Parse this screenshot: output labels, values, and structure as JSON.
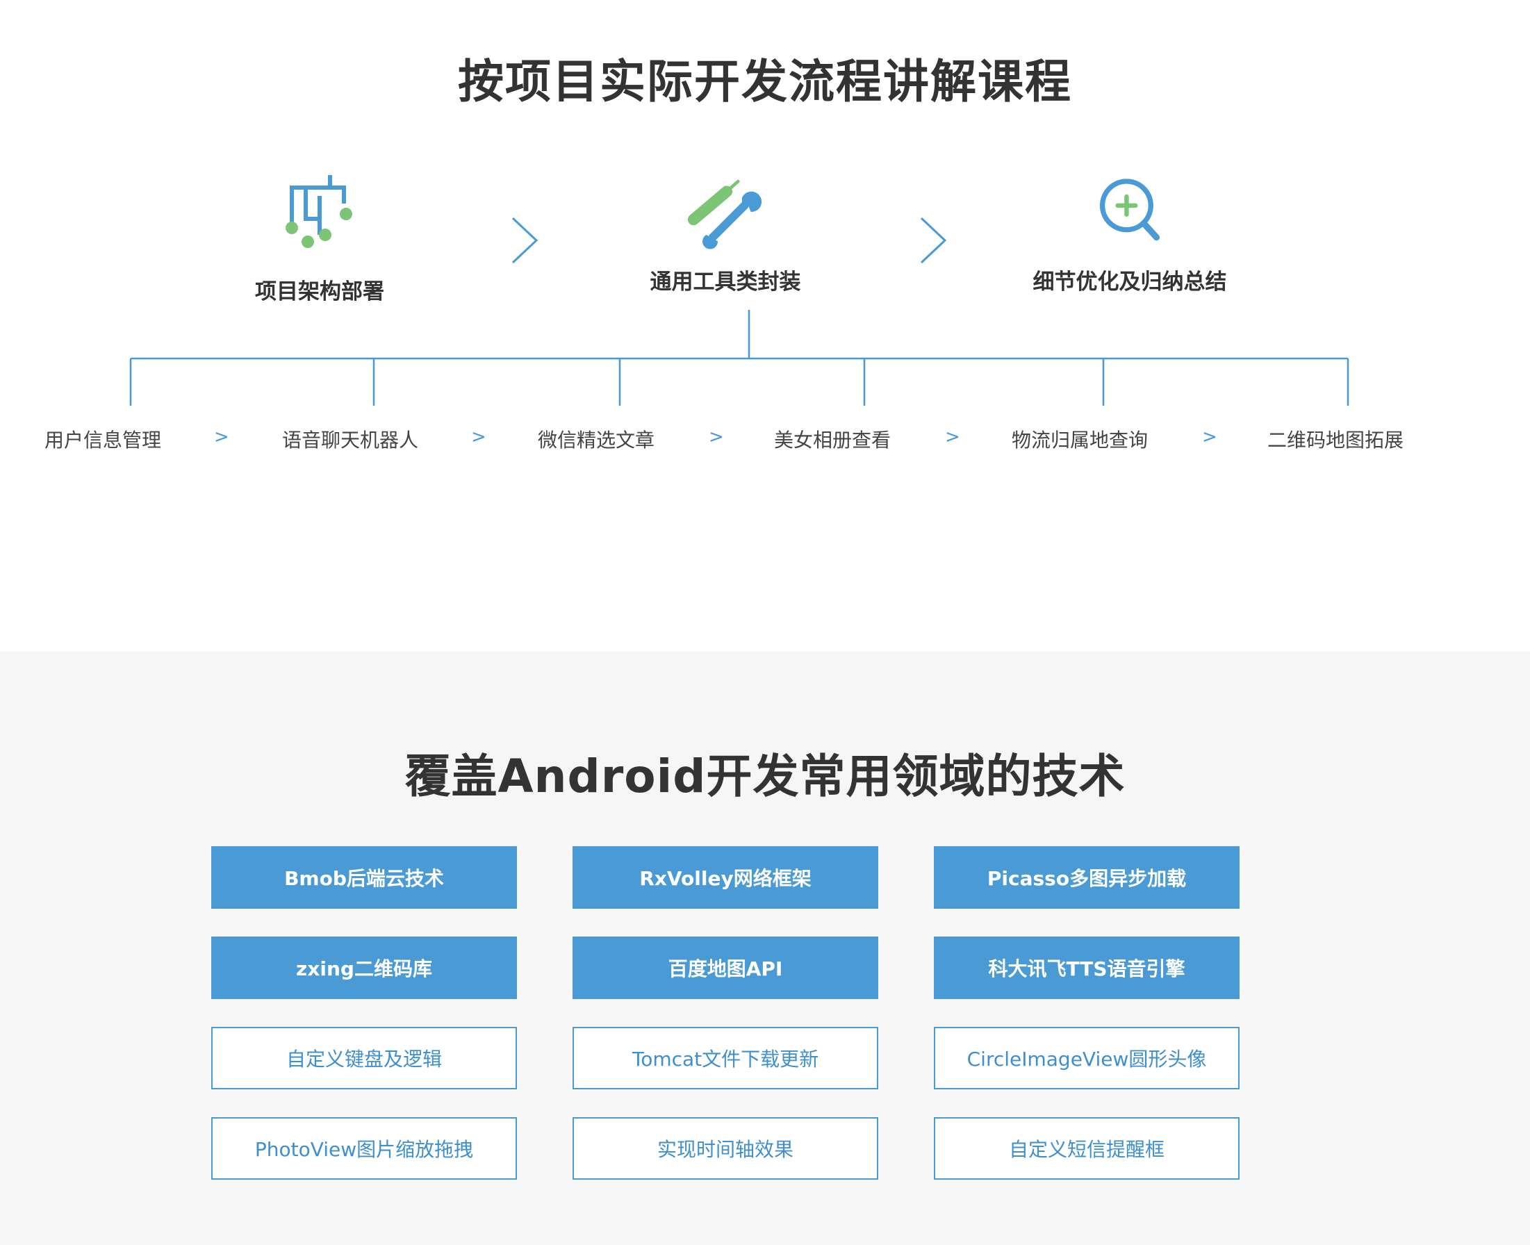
{
  "section_top": {
    "title": "按项目实际开发流程讲解课程",
    "phases": [
      {
        "label": "项目架构部署",
        "icon": "hierarchy-icon"
      },
      {
        "label": "通用工具类封装",
        "icon": "tools-icon"
      },
      {
        "label": "细节优化及归纳总结",
        "icon": "zoom-in-icon"
      }
    ],
    "steps": [
      "用户信息管理",
      "语音聊天机器人",
      "微信精选文章",
      "美女相册查看",
      "物流归属地查询",
      "二维码地图拓展"
    ],
    "step_separator": ">"
  },
  "section_bottom": {
    "title": "覆盖Android开发常用领域的技术",
    "techs": [
      {
        "label": "Bmob后端云技术",
        "style": "filled"
      },
      {
        "label": "RxVolley网络框架",
        "style": "filled"
      },
      {
        "label": "Picasso多图异步加载",
        "style": "filled"
      },
      {
        "label": "zxing二维码库",
        "style": "filled"
      },
      {
        "label": "百度地图API",
        "style": "filled"
      },
      {
        "label": "科大讯飞TTS语音引擎",
        "style": "filled"
      },
      {
        "label": "自定义键盘及逻辑",
        "style": "outline"
      },
      {
        "label": "Tomcat文件下载更新",
        "style": "outline"
      },
      {
        "label": "CircleImageView圆形头像",
        "style": "outline"
      },
      {
        "label": "PhotoView图片缩放拖拽",
        "style": "outline"
      },
      {
        "label": "实现时间轴效果",
        "style": "outline"
      },
      {
        "label": "自定义短信提醒框",
        "style": "outline"
      }
    ]
  },
  "colors": {
    "accent_blue": "#4a9ad6",
    "accent_green": "#7cc576",
    "text_dark": "#333333",
    "bottom_bg": "#f6f6f6"
  }
}
